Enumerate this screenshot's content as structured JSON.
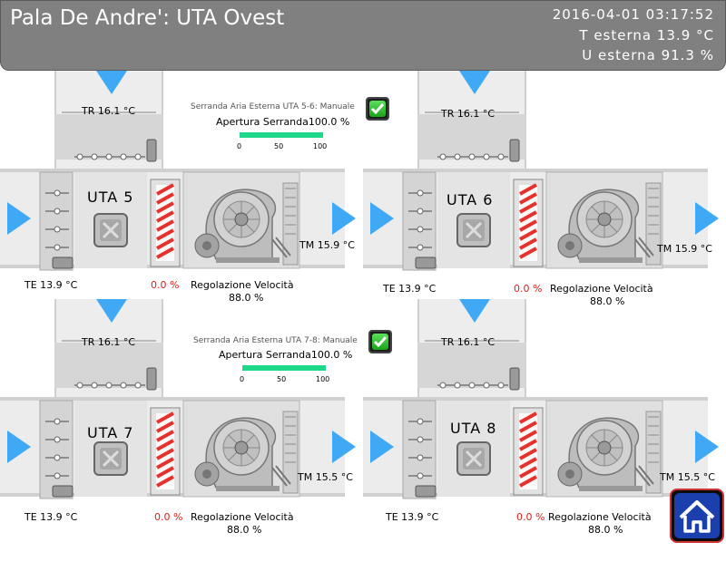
{
  "header": {
    "title": "Pala De Andre': UTA Ovest",
    "datetime": "2016-04-01  03:17:52",
    "t_ext": "T  esterna   13.9  °C",
    "u_ext": "U  esterna   91.3  %"
  },
  "units": [
    {
      "name": "UTA   5",
      "tr": "TR  16.1 °C",
      "te": "TE  13.9 °C",
      "tm": "TM  15.9 °C",
      "pct": "0.0 %",
      "reg_label": "Regolazione Velocità",
      "reg_val": "88.0 %"
    },
    {
      "name": "UTA   6",
      "tr": "TR  16.1 °C",
      "te": "TE  13.9 °C",
      "tm": "TM  15.9 °C",
      "pct": "0.0 %",
      "reg_label": "Regolazione Velocità",
      "reg_val": "88.0 %"
    },
    {
      "name": "UTA   7",
      "tr": "TR  16.1 °C",
      "te": "TE  13.9 °C",
      "tm": "TM  15.5 °C",
      "pct": "0.0 %",
      "reg_label": "Regolazione Velocità",
      "reg_val": "88.0 %"
    },
    {
      "name": "UTA   8",
      "tr": "TR  16.1 °C",
      "te": "TE  13.9 °C",
      "tm": "TM  15.5 °C",
      "pct": "0.0 %",
      "reg_label": "Regolazione Velocità",
      "reg_val": "88.0 %"
    }
  ],
  "dampers": [
    {
      "title": "Serranda Aria Esterna UTA 5-6: Manuale",
      "opening": "Apertura Serranda100.0 %",
      "scale": [
        "0",
        "50",
        "100"
      ],
      "level": 1.0
    },
    {
      "title": "Serranda Aria Esterna UTA 7-8: Manuale",
      "opening": "Apertura Serranda100.0 %",
      "scale": [
        "0",
        "50",
        "100"
      ],
      "level": 1.0
    }
  ],
  "colors": {
    "header_bg": "#808080",
    "arrow": "#3fa9f5",
    "bar": "#1ed88a",
    "red_text": "#e0201c",
    "home": "#1c3fae"
  },
  "icons": {
    "arrow": "triangle-arrow-icon",
    "check": "check-icon",
    "home": "home-icon"
  }
}
